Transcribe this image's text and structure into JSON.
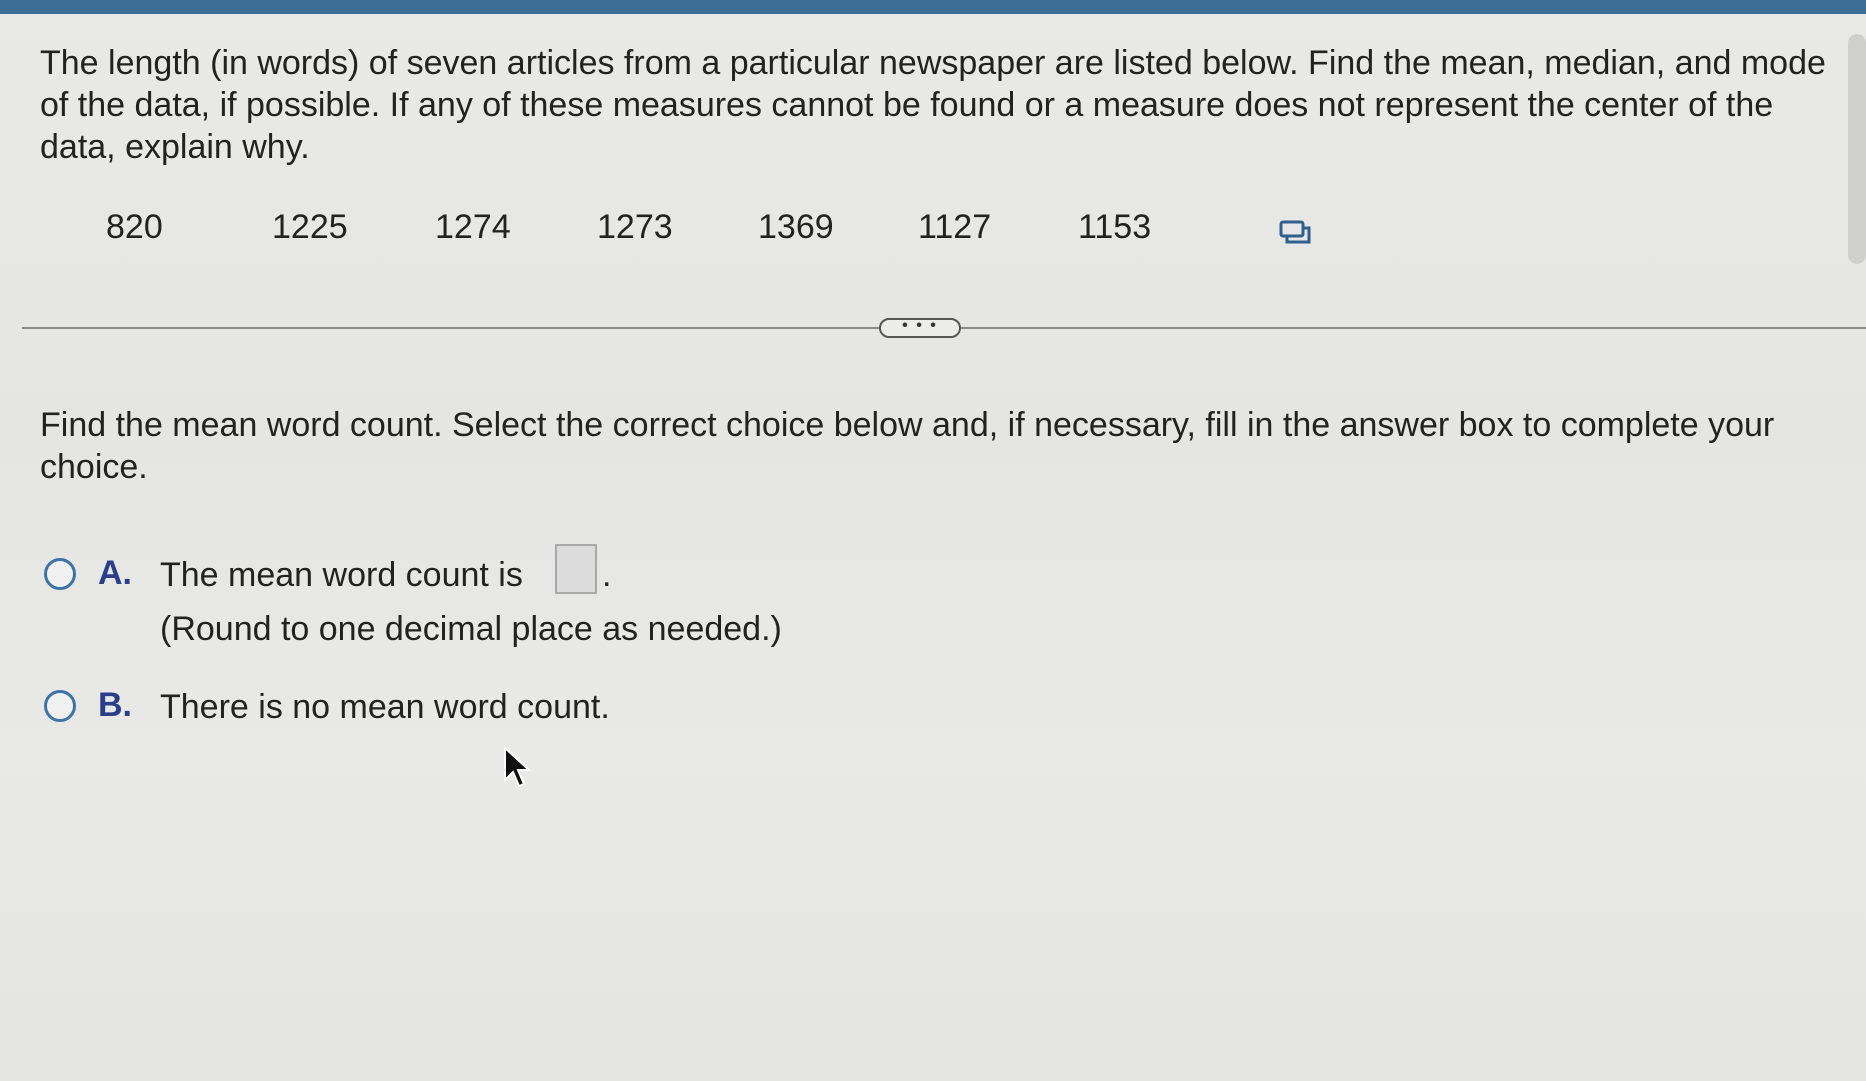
{
  "question": {
    "text": "The length (in words) of seven articles from a particular newspaper are listed below. Find the mean, median, and mode of the data, if possible. If any of these measures cannot be found or a measure does not represent the center of the data, explain why."
  },
  "data_values": [
    "820",
    "1225",
    "1274",
    "1273",
    "1369",
    "1127",
    "1153"
  ],
  "icons": {
    "copy": "copy-data-icon",
    "expand": "more-dots-icon",
    "cursor": "mouse-pointer-icon"
  },
  "expand_label": "• • •",
  "prompt": {
    "text": "Find the mean word count. Select the correct choice below and, if necessary, fill in the answer box to complete your choice."
  },
  "choices": {
    "a": {
      "letter": "A.",
      "text": "The mean word count is",
      "answer_value": "",
      "period": ".",
      "hint": "(Round to one decimal place as needed.)"
    },
    "b": {
      "letter": "B.",
      "text": "There is no mean word count."
    }
  },
  "colors": {
    "top_bar": "#3d6e96",
    "choice_letter": "#2a3f8a",
    "radio_border": "#3c74a8"
  }
}
